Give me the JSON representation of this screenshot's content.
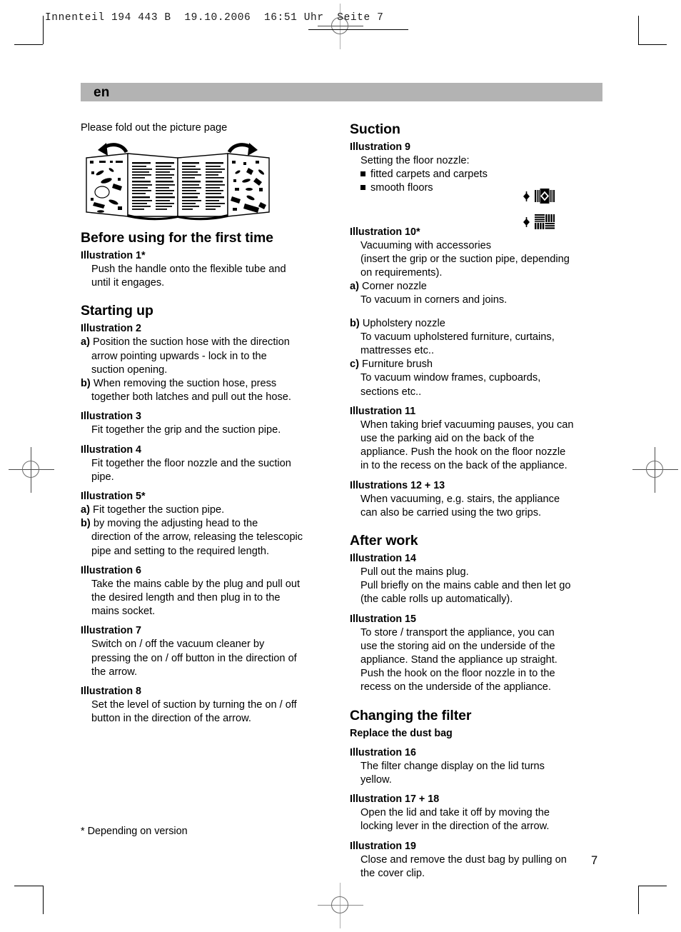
{
  "print_slug": "Innenteil 194 443 B  19.10.2006  16:51 Uhr  Seite 7",
  "language_banner": "en",
  "page_number": "7",
  "footnote": "* Depending on version",
  "intro": "Please fold out the picture page",
  "illustration_alt": "fold-out-booklet-illustration",
  "left_column": {
    "sections": [
      {
        "heading": "Before using for the first time",
        "blocks": [
          {
            "title": "Illustration 1*",
            "lines": [
              "Push the handle onto the flexible tube and",
              "until it engages."
            ]
          }
        ]
      },
      {
        "heading": "Starting up",
        "blocks": [
          {
            "title": "Illustration 2",
            "items": [
              {
                "marker": "a)",
                "lines": [
                  "Position the suction hose with the direction",
                  "arrow pointing upwards - lock in to the",
                  "suction opening."
                ]
              },
              {
                "marker": "b)",
                "lines": [
                  "When removing the suction hose, press",
                  "together both latches and pull out the hose."
                ]
              }
            ]
          },
          {
            "title": "Illustration 3",
            "lines": [
              "Fit together the grip and the suction pipe."
            ]
          },
          {
            "title": "Illustration 4",
            "lines": [
              "Fit together the floor nozzle and the suction",
              "pipe."
            ]
          },
          {
            "title": "Illustration 5*",
            "items": [
              {
                "marker": "a)",
                "lines": [
                  "Fit together the suction pipe."
                ]
              },
              {
                "marker": "b)",
                "lines": [
                  "by moving the adjusting head to the",
                  "direction of the arrow, releasing the telescopic",
                  "pipe and setting to the required length."
                ]
              }
            ]
          },
          {
            "title": "Illustration 6",
            "lines": [
              "Take the mains cable by the plug and pull out",
              "the desired length and then plug in to the",
              "mains socket."
            ]
          },
          {
            "title": "Illustration 7",
            "lines": [
              "Switch on / off the vacuum cleaner by",
              "pressing the on / off button in the direction of",
              "the arrow."
            ]
          },
          {
            "title": "Illustration 8",
            "lines": [
              "Set the level of suction by turning the on / off",
              "button in the direction of the arrow."
            ]
          }
        ]
      }
    ]
  },
  "right_column": {
    "suction": {
      "heading": "Suction",
      "illustration9": {
        "title": "Illustration 9",
        "intro": "Setting the floor nozzle:",
        "bullets": [
          {
            "label": "fitted carpets and carpets",
            "icon": "carpet-pictogram"
          },
          {
            "label": "smooth floors",
            "icon": "smooth-floor-pictogram"
          }
        ]
      },
      "illustration10": {
        "title": "Illustration 10*",
        "lines": [
          "Vacuuming with accessories",
          "(insert the grip or the suction pipe, depending",
          "on requirements)."
        ],
        "items": [
          {
            "marker": "a)",
            "lines": [
              "Corner nozzle",
              "To vacuum in corners and joins."
            ]
          },
          {
            "marker": "b)",
            "lines": [
              "Upholstery nozzle",
              "To vacuum upholstered furniture, curtains,",
              "mattresses etc.."
            ]
          },
          {
            "marker": "c)",
            "lines": [
              "Furniture brush",
              "To vacuum window frames, cupboards,",
              "sections etc.."
            ]
          }
        ]
      },
      "illustration11": {
        "title": "Illustration 11",
        "lines": [
          "When taking brief vacuuming pauses, you can",
          "use the parking aid on the back of the",
          "appliance. Push the hook on the floor nozzle",
          "in to the recess on the back of the appliance."
        ]
      },
      "illustration12_13": {
        "title": "Illustrations 12 + 13",
        "lines": [
          "When vacuuming, e.g. stairs, the appliance",
          "can also be carried using the two grips."
        ]
      }
    },
    "after_work": {
      "heading": "After work",
      "illustration14": {
        "title": "Illustration 14",
        "lines": [
          "Pull out the mains plug.",
          "Pull briefly on the mains cable and then let go",
          "(the cable rolls up automatically)."
        ]
      },
      "illustration15": {
        "title": "Illustration 15",
        "lines": [
          "To store / transport the appliance, you can",
          "use the storing aid on the underside of the",
          "appliance. Stand the appliance up straight.",
          "Push the hook on the floor nozzle in to the",
          "recess on the underside of the appliance."
        ]
      }
    },
    "changing_filter": {
      "heading": "Changing the filter",
      "subheading": "Replace the dust bag",
      "illustration16": {
        "title": "Illustration 16",
        "lines": [
          "The filter change display on the lid turns",
          "yellow."
        ]
      },
      "illustration17_18": {
        "title": "Illustration 17 + 18",
        "lines": [
          "Open the lid and take it off by moving the",
          "locking lever in the direction of the arrow."
        ]
      },
      "illustration19": {
        "title": "Illustration 19",
        "lines": [
          "Close and remove the dust bag by pulling on",
          "the cover clip."
        ]
      }
    }
  }
}
